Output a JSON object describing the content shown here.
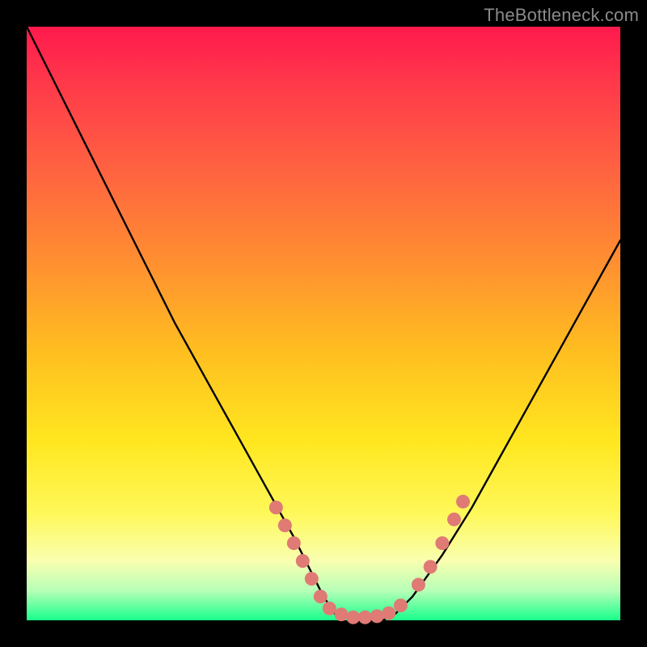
{
  "watermark": "TheBottleneck.com",
  "chart_data": {
    "type": "line",
    "title": "",
    "xlabel": "",
    "ylabel": "",
    "xlim": [
      0,
      100
    ],
    "ylim": [
      0,
      100
    ],
    "grid": false,
    "legend": null,
    "series": [
      {
        "name": "bottleneck-curve",
        "x": [
          0,
          5,
          10,
          15,
          20,
          25,
          30,
          35,
          40,
          45,
          48,
          50,
          52,
          55,
          58,
          60,
          62,
          65,
          70,
          75,
          80,
          85,
          90,
          95,
          100
        ],
        "y": [
          100,
          90,
          80,
          70,
          60,
          50,
          41,
          32,
          23,
          14,
          8,
          4,
          1,
          0,
          0,
          0,
          1,
          4,
          11,
          19,
          28,
          37,
          46,
          55,
          64
        ],
        "color": "#000000"
      }
    ],
    "highlight_points": {
      "name": "marker-dots",
      "color": "#e07a74",
      "points": [
        {
          "x": 42,
          "y": 19
        },
        {
          "x": 43.5,
          "y": 16
        },
        {
          "x": 45,
          "y": 13
        },
        {
          "x": 46.5,
          "y": 10
        },
        {
          "x": 48,
          "y": 7
        },
        {
          "x": 49.5,
          "y": 4
        },
        {
          "x": 51,
          "y": 2
        },
        {
          "x": 53,
          "y": 1
        },
        {
          "x": 55,
          "y": 0.5
        },
        {
          "x": 57,
          "y": 0.5
        },
        {
          "x": 59,
          "y": 0.7
        },
        {
          "x": 61,
          "y": 1.2
        },
        {
          "x": 63,
          "y": 2.5
        },
        {
          "x": 66,
          "y": 6
        },
        {
          "x": 68,
          "y": 9
        },
        {
          "x": 70,
          "y": 13
        },
        {
          "x": 72,
          "y": 17
        },
        {
          "x": 73.5,
          "y": 20
        }
      ]
    },
    "gradient_stops": [
      {
        "pos": 0,
        "color": "#ff1a4d"
      },
      {
        "pos": 10,
        "color": "#ff3a4a"
      },
      {
        "pos": 25,
        "color": "#ff6540"
      },
      {
        "pos": 40,
        "color": "#ff9030"
      },
      {
        "pos": 55,
        "color": "#ffbf20"
      },
      {
        "pos": 70,
        "color": "#ffe720"
      },
      {
        "pos": 82,
        "color": "#fff85a"
      },
      {
        "pos": 90,
        "color": "#f9ffb0"
      },
      {
        "pos": 95,
        "color": "#b7ffb7"
      },
      {
        "pos": 100,
        "color": "#19ff8c"
      }
    ]
  }
}
